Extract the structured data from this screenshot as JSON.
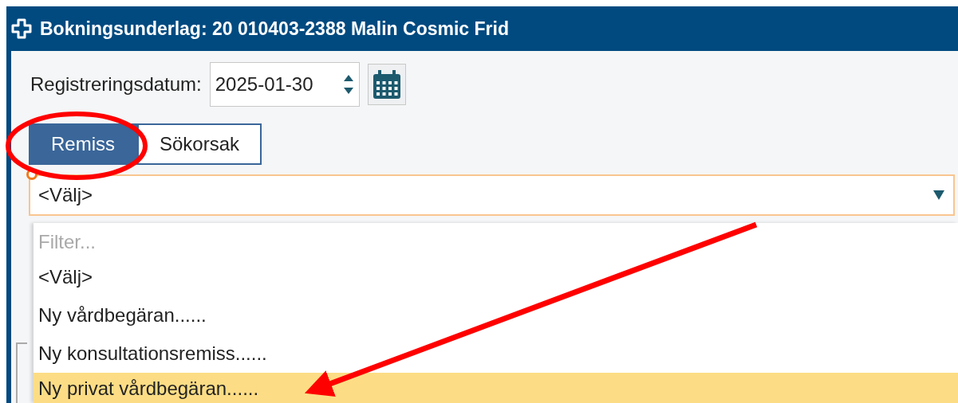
{
  "window": {
    "title": "Bokningsunderlag: 20 010403-2388 Malin Cosmic Frid"
  },
  "registration_date": {
    "label": "Registreringsdatum:",
    "value": "2025-01-30"
  },
  "tabs": [
    {
      "label": "Remiss",
      "selected": true,
      "circled": true
    },
    {
      "label": "Sökorsak",
      "selected": false,
      "circled": false
    }
  ],
  "dropdown": {
    "required": true,
    "value": "<Välj>",
    "expanded": true,
    "filter": {
      "placeholder": "Filter..."
    },
    "options": [
      {
        "label": "<Välj>",
        "highlighted": false,
        "arrow_pointed": false
      },
      {
        "label": "Ny vårdbegäran......",
        "highlighted": false,
        "arrow_pointed": false
      },
      {
        "label": "Ny konsultationsremiss......",
        "highlighted": false,
        "arrow_pointed": false
      },
      {
        "label": "Ny privat vårdbegäran......",
        "highlighted": true,
        "arrow_pointed": true
      }
    ]
  }
}
